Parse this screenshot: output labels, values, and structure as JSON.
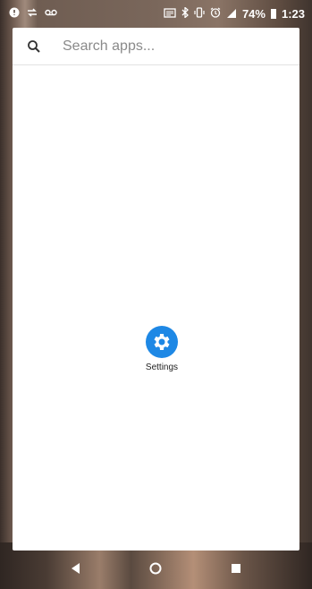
{
  "status_bar": {
    "left_icons": [
      "circle-badge-icon",
      "sync-arrows-icon",
      "voicemail-icon"
    ],
    "right_icons": [
      "cast-icon",
      "bluetooth-icon",
      "vibrate-icon",
      "alarm-icon",
      "signal-icon"
    ],
    "battery_percent": "74%",
    "time": "1:23"
  },
  "search": {
    "placeholder": "Search apps..."
  },
  "apps": [
    {
      "label": "Settings",
      "icon": "gear-icon",
      "color": "#1e88e5"
    }
  ],
  "nav_bar": {
    "buttons": [
      "back-icon",
      "home-icon",
      "recents-icon"
    ]
  }
}
